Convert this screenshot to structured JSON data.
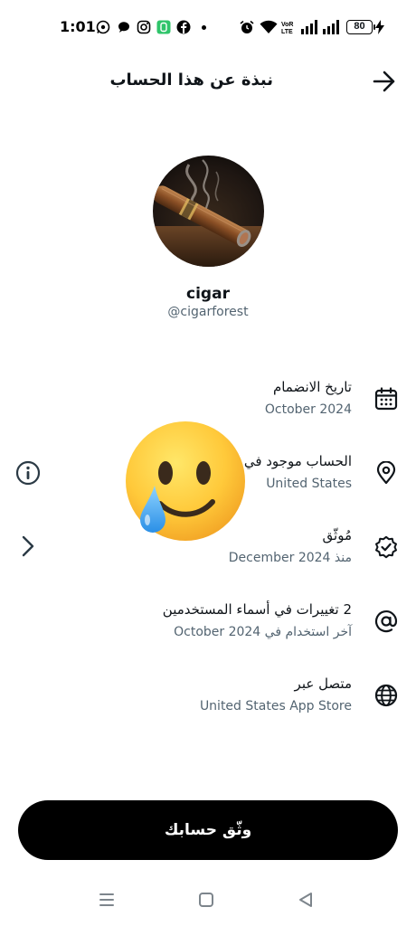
{
  "status_bar": {
    "time": "1:01",
    "battery": "80",
    "icons": [
      "whatsapp-icon",
      "chat-icon",
      "instagram-icon",
      "app-icon",
      "facebook-icon",
      "alarm-icon",
      "wifi-icon",
      "volte-icon",
      "signal-icon",
      "signal-icon",
      "charging-icon"
    ]
  },
  "header": {
    "title": "نبذة عن هذا الحساب",
    "back_icon": "arrow-right-icon"
  },
  "profile": {
    "display_name": "cigar",
    "handle": "@cigarforest"
  },
  "rows": [
    {
      "icon": "calendar-icon",
      "title": "تاريخ الانضمام",
      "subtitle": "October 2024"
    },
    {
      "icon": "location-pin-icon",
      "title": "الحساب موجود في",
      "subtitle": "United States"
    },
    {
      "icon": "verified-badge-icon",
      "title": "مُوثّق",
      "subtitle": "منذ December 2024"
    },
    {
      "icon": "at-sign-icon",
      "title": "2 تغييرات في أسماء المستخدمين",
      "subtitle": "آخر استخدام في October 2024"
    },
    {
      "icon": "globe-icon",
      "title": "متصل عبر",
      "subtitle": "United States App Store"
    }
  ],
  "overlay_emoji": "smiling-face-with-tear-emoji",
  "side_controls": [
    "info-icon",
    "chevron-right-icon"
  ],
  "verify_button": {
    "label": "وثّق حسابك"
  },
  "nav_bar": [
    "menu-icon",
    "home-square-icon",
    "back-triangle-icon"
  ]
}
